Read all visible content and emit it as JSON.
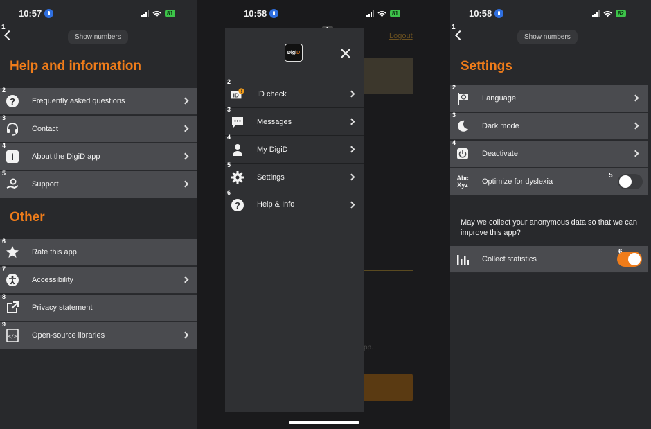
{
  "panel1": {
    "time": "10:57",
    "battery": "81",
    "step_label": "1",
    "show_numbers": "Show numbers",
    "heading_help": "Help and information",
    "help_items": [
      {
        "num": "2",
        "label": "Frequently asked questions",
        "icon": "question-circle-icon"
      },
      {
        "num": "3",
        "label": "Contact",
        "icon": "headset-icon"
      },
      {
        "num": "4",
        "label": "About the DigiD app",
        "icon": "info-icon"
      },
      {
        "num": "5",
        "label": "Support",
        "icon": "hand-gear-icon"
      }
    ],
    "heading_other": "Other",
    "other_items": [
      {
        "num": "6",
        "label": "Rate this app",
        "icon": "star-icon"
      },
      {
        "num": "7",
        "label": "Accessibility",
        "icon": "accessibility-icon"
      },
      {
        "num": "8",
        "label": "Privacy statement",
        "icon": "external-link-icon"
      },
      {
        "num": "9",
        "label": "Open-source libraries",
        "icon": "code-file-icon"
      }
    ]
  },
  "panel2": {
    "time": "10:58",
    "battery": "81",
    "step_label": "1",
    "logo_text_a": "Digi",
    "logo_text_b": "D",
    "background_logout": "Logout",
    "background_text": "pp.",
    "menu_items": [
      {
        "num": "2",
        "label": "ID check",
        "icon": "id-check-icon"
      },
      {
        "num": "3",
        "label": "Messages",
        "icon": "chat-icon"
      },
      {
        "num": "4",
        "label": "My DigiD",
        "icon": "person-icon"
      },
      {
        "num": "5",
        "label": "Settings",
        "icon": "gear-icon"
      },
      {
        "num": "6",
        "label": "Help & Info",
        "icon": "question-circle-icon"
      }
    ]
  },
  "panel3": {
    "time": "10:58",
    "battery": "82",
    "step_label": "1",
    "show_numbers": "Show numbers",
    "heading": "Settings",
    "items": [
      {
        "num": "2",
        "label": "Language",
        "icon": "flag-icon"
      },
      {
        "num": "3",
        "label": "Dark mode",
        "icon": "moon-icon"
      },
      {
        "num": "4",
        "label": "Deactivate",
        "icon": "power-icon"
      }
    ],
    "dyslexia_num": "5",
    "dyslexia_label": "Optimize for dyslexia",
    "dyslexia_icon_top": "Abc",
    "dyslexia_icon_bottom": "Xyz",
    "dyslexia_on": false,
    "stats_question": "May we collect your anonymous data so that we can improve this app?",
    "stats_num": "6",
    "stats_label": "Collect statistics",
    "stats_on": true
  },
  "colors": {
    "accent": "#ef7c1a",
    "row": "#4a4b4f",
    "bg": "#28292c"
  }
}
